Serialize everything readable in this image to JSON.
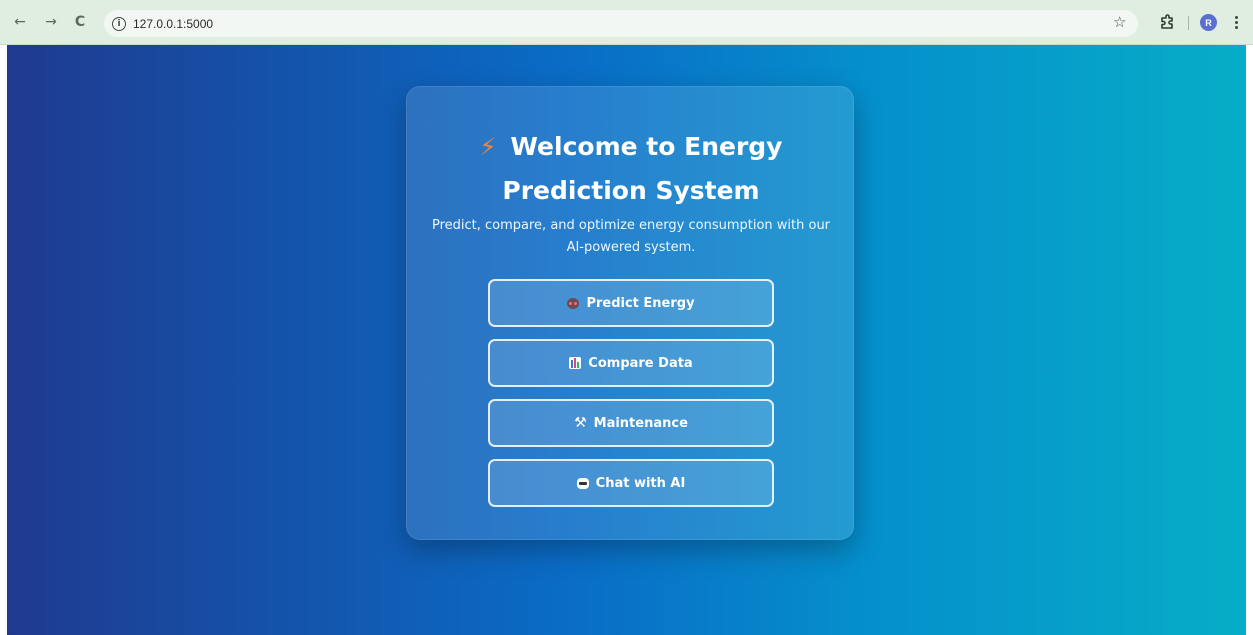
{
  "browser": {
    "url": "127.0.0.1:5000",
    "profile_initial": "R",
    "icons": [
      "back-arrow-icon",
      "forward-arrow-icon",
      "reload-icon",
      "site-info-icon",
      "bookmark-star-icon",
      "extensions-icon",
      "profile-avatar",
      "menu-icon"
    ]
  },
  "card": {
    "title": "Welcome to Energy Prediction System",
    "title_icon": "lightning-bolt-icon",
    "subtitle": "Predict, compare, and optimize energy consumption with our AI-powered system.",
    "buttons": [
      {
        "label": "Predict Energy",
        "icon": "robot-face-icon"
      },
      {
        "label": "Compare Data",
        "icon": "bar-chart-icon"
      },
      {
        "label": "Maintenance",
        "icon": "hammer-wrench-icon"
      },
      {
        "label": "Chat with AI",
        "icon": "bot-icon"
      }
    ]
  },
  "colors": {
    "gradient_start": "#1f3a8f",
    "gradient_mid": "#0a6cc6",
    "gradient_end": "#06adc6",
    "bolt": "#f5843a",
    "chrome_bar": "#dfeee0"
  }
}
